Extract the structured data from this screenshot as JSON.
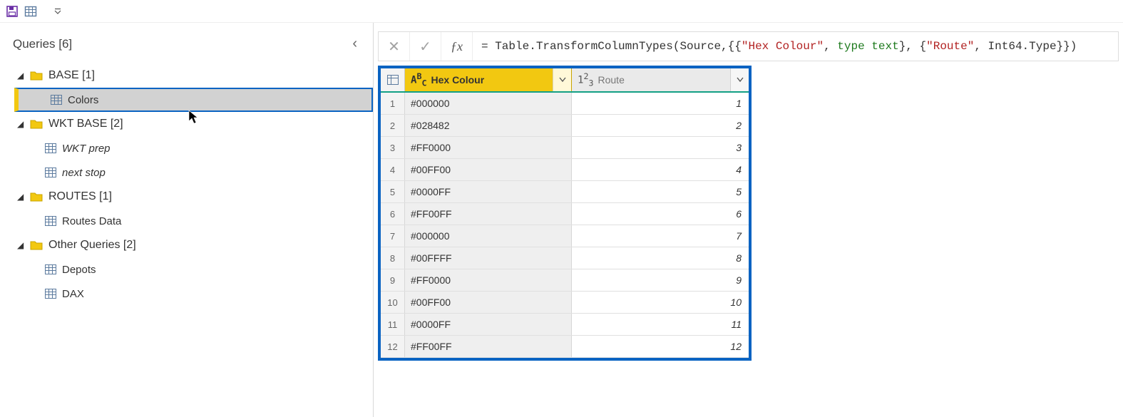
{
  "sidebar": {
    "title": "Queries [6]",
    "folders": [
      {
        "label": "BASE [1]",
        "items": [
          {
            "label": "Colors",
            "italic": false,
            "selected": true
          }
        ]
      },
      {
        "label": "WKT BASE [2]",
        "items": [
          {
            "label": "WKT prep",
            "italic": true
          },
          {
            "label": "next stop",
            "italic": true
          }
        ]
      },
      {
        "label": "ROUTES [1]",
        "items": [
          {
            "label": "Routes Data",
            "italic": false
          }
        ]
      },
      {
        "label": "Other Queries [2]",
        "items": [
          {
            "label": "Depots",
            "italic": false
          },
          {
            "label": "DAX",
            "italic": false
          }
        ]
      }
    ]
  },
  "formula": {
    "prefix": "= Table.TransformColumnTypes(Source,{{",
    "str1": "\"Hex Colour\"",
    "sep1": ", ",
    "kw1": "type text",
    "mid": "}, {",
    "str2": "\"Route\"",
    "sep2": ", Int64.Type}})"
  },
  "columns": {
    "col1_type": "A",
    "col1_type_sup": "B",
    "col1_type_sub": "C",
    "col1_label": "Hex Colour",
    "col2_type_a": "1",
    "col2_type_b": "2",
    "col2_type_c": "3",
    "col2_label": "Route"
  },
  "rows": [
    {
      "n": "1",
      "hex": "#000000",
      "route": "1"
    },
    {
      "n": "2",
      "hex": "#028482",
      "route": "2"
    },
    {
      "n": "3",
      "hex": "#FF0000",
      "route": "3"
    },
    {
      "n": "4",
      "hex": "#00FF00",
      "route": "4"
    },
    {
      "n": "5",
      "hex": "#0000FF",
      "route": "5"
    },
    {
      "n": "6",
      "hex": "#FF00FF",
      "route": "6"
    },
    {
      "n": "7",
      "hex": "#000000",
      "route": "7"
    },
    {
      "n": "8",
      "hex": "#00FFFF",
      "route": "8"
    },
    {
      "n": "9",
      "hex": "#FF0000",
      "route": "9"
    },
    {
      "n": "10",
      "hex": "#00FF00",
      "route": "10"
    },
    {
      "n": "11",
      "hex": "#0000FF",
      "route": "11"
    },
    {
      "n": "12",
      "hex": "#FF00FF",
      "route": "12"
    }
  ]
}
